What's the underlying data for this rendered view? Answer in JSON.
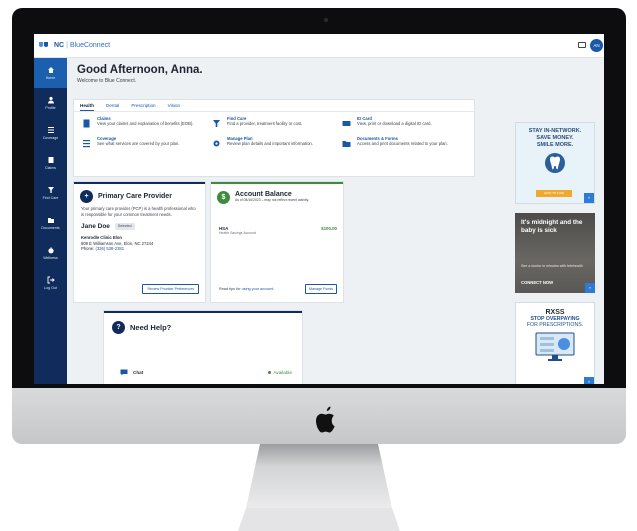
{
  "header": {
    "brand_nc": "NC",
    "brand_name": "BlueConnect",
    "avatar_initials": "AN"
  },
  "sidebar": {
    "items": [
      {
        "label": "Home"
      },
      {
        "label": "Profile"
      },
      {
        "label": "Coverage"
      },
      {
        "label": "Claims"
      },
      {
        "label": "Find Care"
      },
      {
        "label": "Documents"
      },
      {
        "label": "Wellness"
      },
      {
        "label": "Log Out"
      }
    ]
  },
  "greeting": {
    "title": "Good Afternoon, Anna.",
    "subtitle": "Welcome to Blue Connect."
  },
  "tabs": [
    {
      "label": "Health"
    },
    {
      "label": "Dental"
    },
    {
      "label": "Prescription"
    },
    {
      "label": "Vision"
    }
  ],
  "quick_links": [
    {
      "title": "Claims",
      "desc": "View your claims and explanation of benefits (EOB)."
    },
    {
      "title": "Find Care",
      "desc": "Find a provider, treatment facility or cost."
    },
    {
      "title": "ID Card",
      "desc": "View, print or download a digital ID card."
    },
    {
      "title": "Coverage",
      "desc": "See what services are covered by your plan."
    },
    {
      "title": "Manage Plan",
      "desc": "Review plan details and important information."
    },
    {
      "title": "Documents & Forms",
      "desc": "Access and print documents related to your plan."
    }
  ],
  "pcp": {
    "title": "Primary Care Provider",
    "desc": "Your primary care provider (PCP) is a health professional who is responsible for your common treatment needs.",
    "doctor": "Jane Doe",
    "badge": "Selected",
    "clinic": "Kenrodle Clinic Elon",
    "address": "909 E Williamson Ave, Elon, NC 27244",
    "phone_label": "Phone:",
    "phone": "(336) 538-2381",
    "button": "Review Provider Preferences"
  },
  "balance": {
    "title": "Account Balance",
    "as_of": "As of 08/16/2023 – may not reflect recent activity.",
    "account": "HSA",
    "account_sub": "Health Savings Account",
    "amount": "$100.00",
    "tip": "Read tips for",
    "tip_link": "using your account.",
    "button": "Manage Funds"
  },
  "help": {
    "title": "Need Help?",
    "chat_label": "Chat",
    "status": "Available"
  },
  "ads": {
    "ad1": {
      "line1": "STAY IN-NETWORK.",
      "line2": "SAVE MONEY.",
      "line3": "SMILE MORE.",
      "button": "HOW TO FIND"
    },
    "ad2": {
      "headline": "It's midnight and the baby is sick",
      "sub": "See a doctor in minutes with telehealth",
      "cta": "CONNECT NOW"
    },
    "ad3": {
      "brand": "RXSS",
      "line1": "STOP OVERPAYING",
      "line2": "FOR PRESCRIPTIONS."
    }
  },
  "colors": {
    "nav": "#0f2c5c",
    "accent": "#1a57a7",
    "green": "#3f8b3d"
  }
}
